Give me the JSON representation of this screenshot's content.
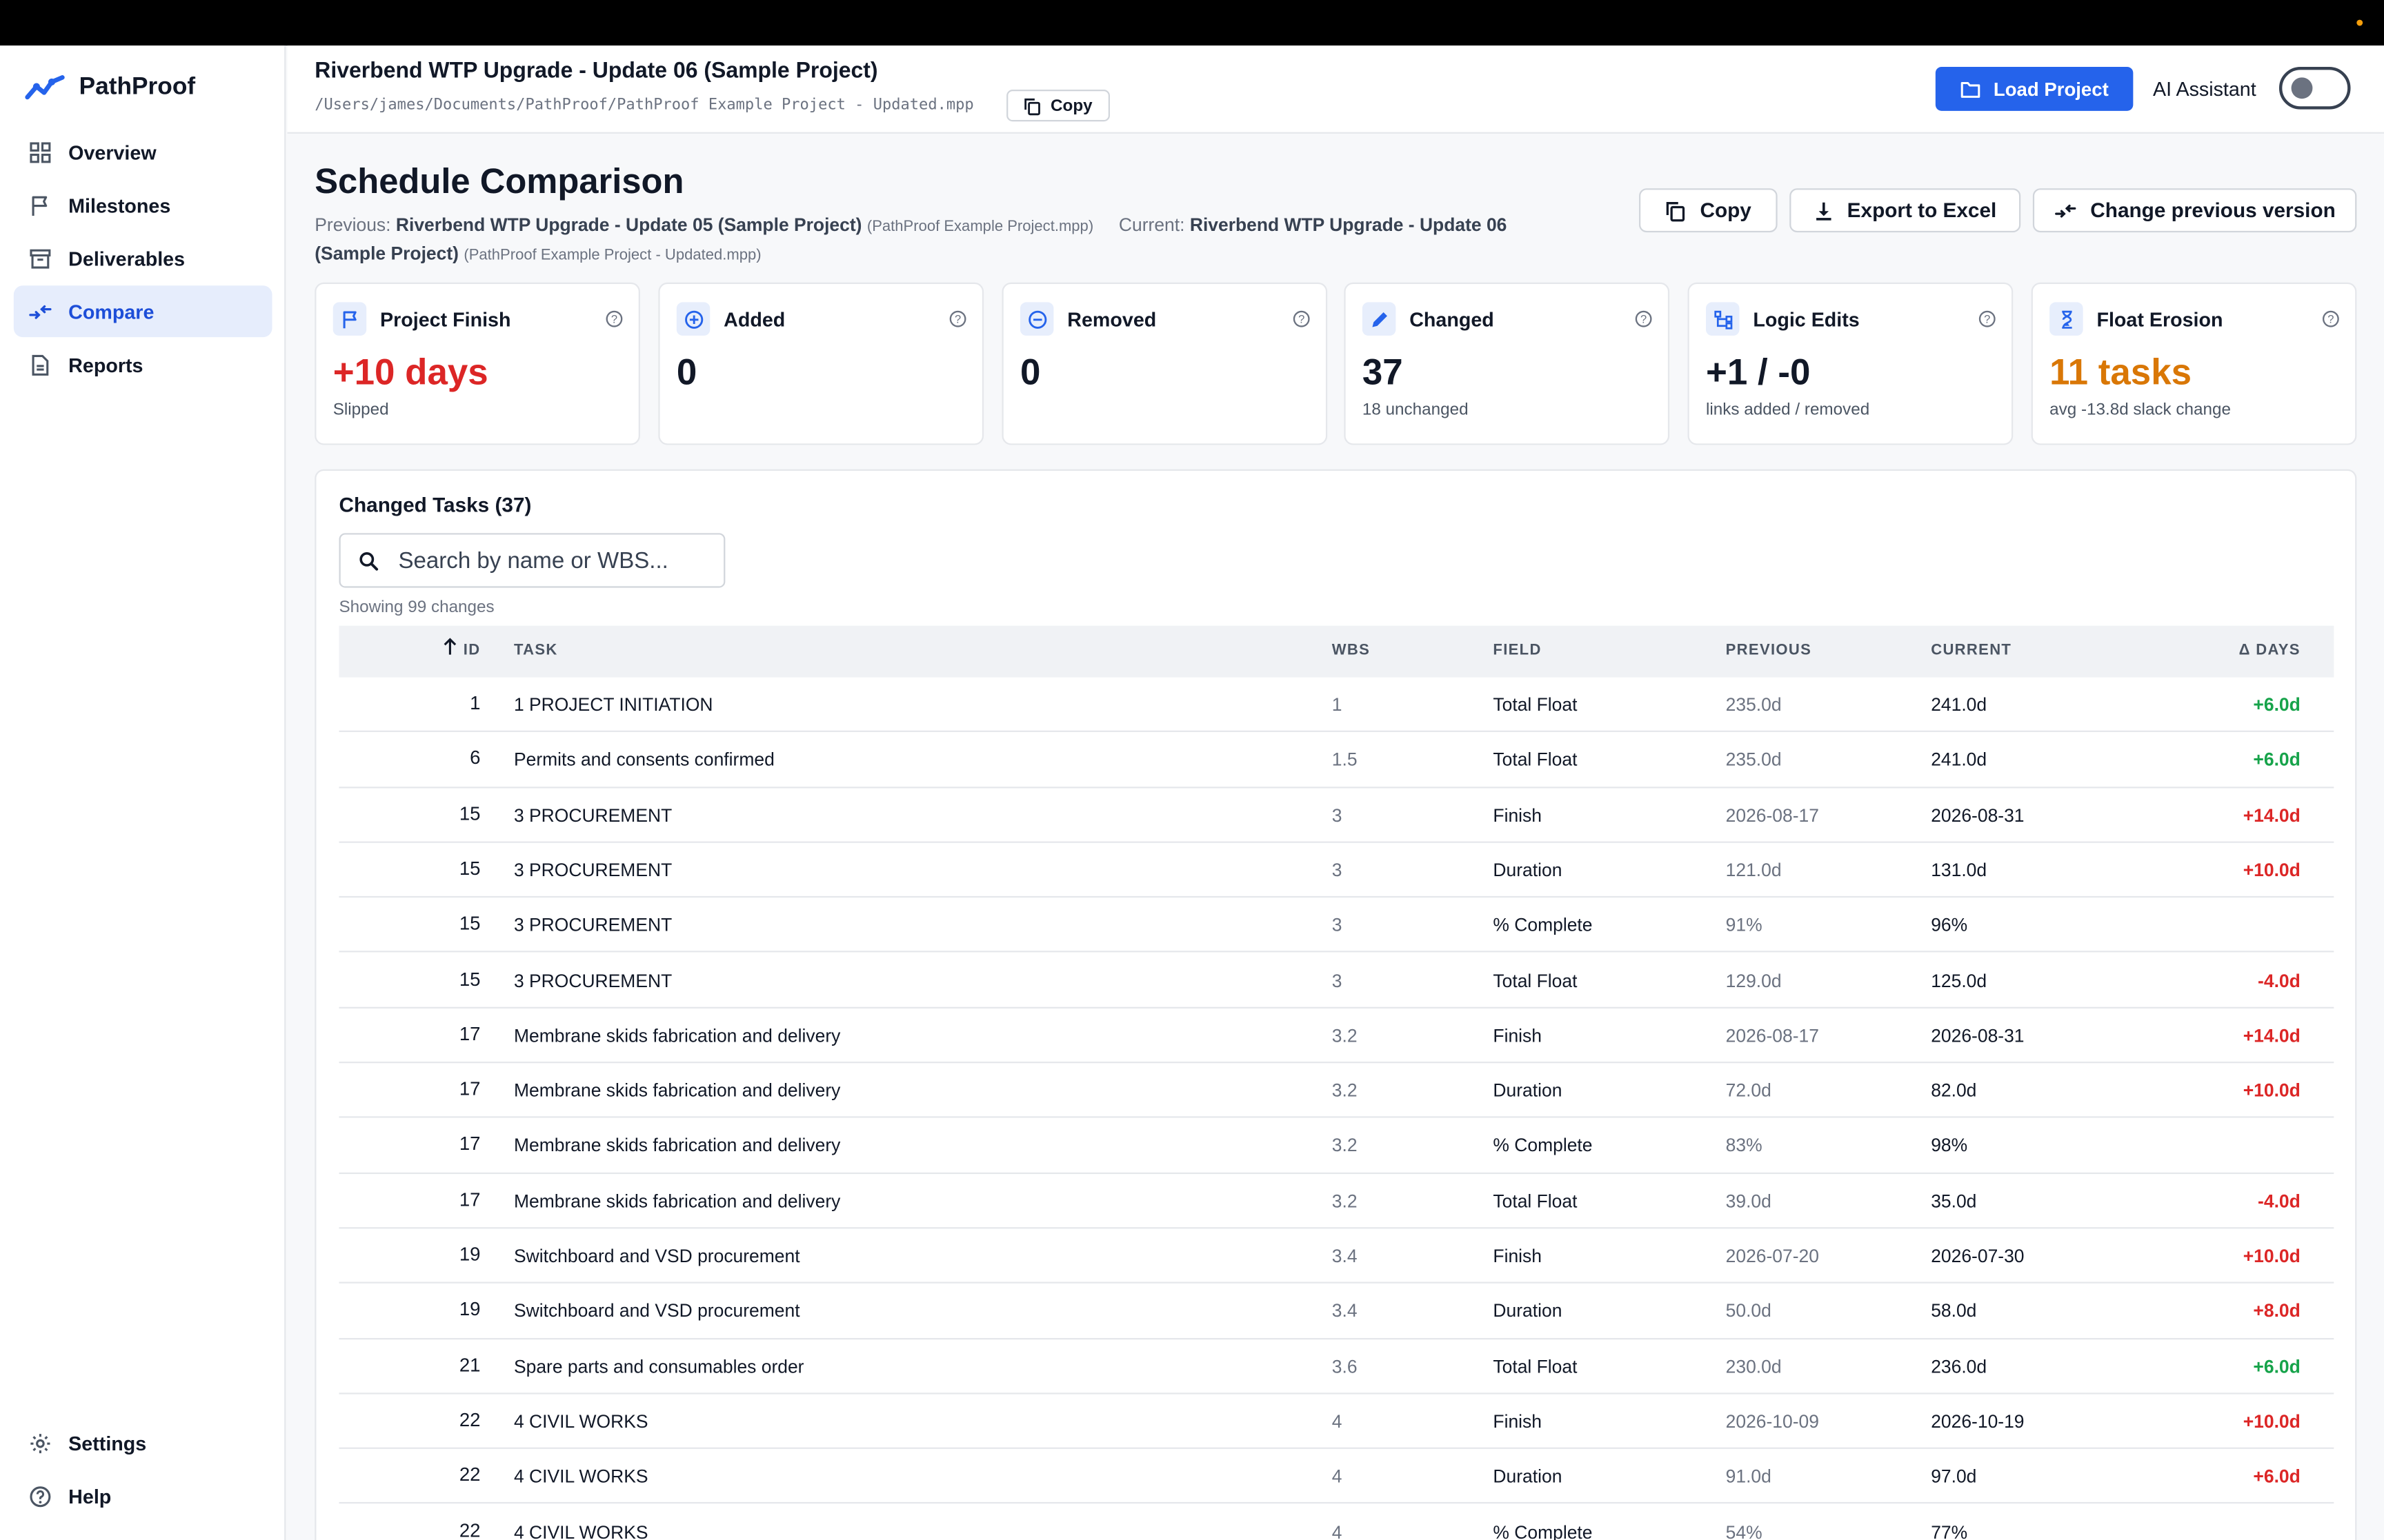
{
  "app": {
    "name": "PathProof"
  },
  "sidebar": {
    "items": [
      {
        "label": "Overview"
      },
      {
        "label": "Milestones"
      },
      {
        "label": "Deliverables"
      },
      {
        "label": "Compare"
      },
      {
        "label": "Reports"
      }
    ],
    "bottom": [
      {
        "label": "Settings"
      },
      {
        "label": "Help"
      }
    ]
  },
  "header": {
    "project_title": "Riverbend WTP Upgrade - Update 06 (Sample Project)",
    "project_path": "/Users/james/Documents/PathProof/PathProof Example Project - Updated.mpp",
    "copy_label": "Copy",
    "load_label": "Load Project",
    "ai_label": "AI Assistant"
  },
  "page": {
    "title": "Schedule Comparison",
    "previous_label": "Previous:",
    "previous_name": "Riverbend WTP Upgrade - Update 05 (Sample Project)",
    "previous_file": "(PathProof Example Project.mpp)",
    "current_label": "Current:",
    "current_name": "Riverbend WTP Upgrade - Update 06 (Sample Project)",
    "current_file": "(PathProof Example Project - Updated.mpp)",
    "copy_label": "Copy",
    "export_label": "Export to Excel",
    "change_label": "Change previous version"
  },
  "cards": [
    {
      "title": "Project Finish",
      "value": "+10 days",
      "sub": "Slipped",
      "color": "#dc2626"
    },
    {
      "title": "Added",
      "value": "0",
      "sub": "",
      "color": "#111827"
    },
    {
      "title": "Removed",
      "value": "0",
      "sub": "",
      "color": "#111827"
    },
    {
      "title": "Changed",
      "value": "37",
      "sub": "18 unchanged",
      "color": "#111827"
    },
    {
      "title": "Logic Edits",
      "value": "+1 / -0",
      "sub": "links added / removed",
      "color": "#111827"
    },
    {
      "title": "Float Erosion",
      "value": "11 tasks",
      "sub": "avg -13.8d slack change",
      "color": "#d97706"
    }
  ],
  "table": {
    "title": "Changed Tasks (37)",
    "search_placeholder": "Search by name or WBS...",
    "showing": "Showing 99 changes",
    "headers": {
      "id": "ID",
      "task": "TASK",
      "wbs": "WBS",
      "field": "FIELD",
      "previous": "PREVIOUS",
      "current": "CURRENT",
      "delta": "Δ DAYS"
    },
    "rows": [
      {
        "id": "1",
        "task": "1 PROJECT INITIATION",
        "wbs": "1",
        "field": "Total Float",
        "previous": "235.0d",
        "current": "241.0d",
        "delta": "+6.0d",
        "tone": "pos"
      },
      {
        "id": "6",
        "task": "Permits and consents confirmed",
        "wbs": "1.5",
        "field": "Total Float",
        "previous": "235.0d",
        "current": "241.0d",
        "delta": "+6.0d",
        "tone": "pos"
      },
      {
        "id": "15",
        "task": "3 PROCUREMENT",
        "wbs": "3",
        "field": "Finish",
        "previous": "2026-08-17",
        "current": "2026-08-31",
        "delta": "+14.0d",
        "tone": "neg"
      },
      {
        "id": "15",
        "task": "3 PROCUREMENT",
        "wbs": "3",
        "field": "Duration",
        "previous": "121.0d",
        "current": "131.0d",
        "delta": "+10.0d",
        "tone": "neg"
      },
      {
        "id": "15",
        "task": "3 PROCUREMENT",
        "wbs": "3",
        "field": "% Complete",
        "previous": "91%",
        "current": "96%",
        "delta": "",
        "tone": ""
      },
      {
        "id": "15",
        "task": "3 PROCUREMENT",
        "wbs": "3",
        "field": "Total Float",
        "previous": "129.0d",
        "current": "125.0d",
        "delta": "-4.0d",
        "tone": "neg"
      },
      {
        "id": "17",
        "task": "Membrane skids fabrication and delivery",
        "wbs": "3.2",
        "field": "Finish",
        "previous": "2026-08-17",
        "current": "2026-08-31",
        "delta": "+14.0d",
        "tone": "neg"
      },
      {
        "id": "17",
        "task": "Membrane skids fabrication and delivery",
        "wbs": "3.2",
        "field": "Duration",
        "previous": "72.0d",
        "current": "82.0d",
        "delta": "+10.0d",
        "tone": "neg"
      },
      {
        "id": "17",
        "task": "Membrane skids fabrication and delivery",
        "wbs": "3.2",
        "field": "% Complete",
        "previous": "83%",
        "current": "98%",
        "delta": "",
        "tone": ""
      },
      {
        "id": "17",
        "task": "Membrane skids fabrication and delivery",
        "wbs": "3.2",
        "field": "Total Float",
        "previous": "39.0d",
        "current": "35.0d",
        "delta": "-4.0d",
        "tone": "neg"
      },
      {
        "id": "19",
        "task": "Switchboard and VSD procurement",
        "wbs": "3.4",
        "field": "Finish",
        "previous": "2026-07-20",
        "current": "2026-07-30",
        "delta": "+10.0d",
        "tone": "neg"
      },
      {
        "id": "19",
        "task": "Switchboard and VSD procurement",
        "wbs": "3.4",
        "field": "Duration",
        "previous": "50.0d",
        "current": "58.0d",
        "delta": "+8.0d",
        "tone": "neg"
      },
      {
        "id": "21",
        "task": "Spare parts and consumables order",
        "wbs": "3.6",
        "field": "Total Float",
        "previous": "230.0d",
        "current": "236.0d",
        "delta": "+6.0d",
        "tone": "pos"
      },
      {
        "id": "22",
        "task": "4 CIVIL WORKS",
        "wbs": "4",
        "field": "Finish",
        "previous": "2026-10-09",
        "current": "2026-10-19",
        "delta": "+10.0d",
        "tone": "neg"
      },
      {
        "id": "22",
        "task": "4 CIVIL WORKS",
        "wbs": "4",
        "field": "Duration",
        "previous": "91.0d",
        "current": "97.0d",
        "delta": "+6.0d",
        "tone": "neg"
      },
      {
        "id": "22",
        "task": "4 CIVIL WORKS",
        "wbs": "4",
        "field": "% Complete",
        "previous": "54%",
        "current": "77%",
        "delta": "",
        "tone": ""
      }
    ]
  }
}
